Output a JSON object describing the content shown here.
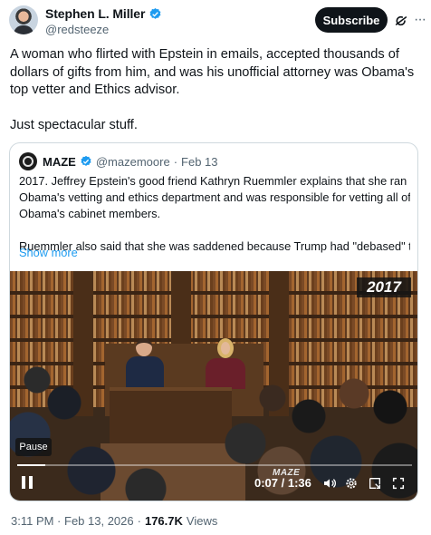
{
  "author": {
    "display_name": "Stephen L. Miller",
    "handle": "@redsteeze",
    "verified_badge_color": "#1d9bf0"
  },
  "header_actions": {
    "subscribe_label": "Subscribe",
    "grok_icon": "grok-icon",
    "more_icon": "more-horizontal-icon",
    "more_label": "···"
  },
  "tweet": {
    "lines": [
      "A woman who flirted with Epstein in emails, accepted thousands of",
      "dollars of gifts from him, and was his unofficial attorney was Obama's",
      "top vetter and Ethics advisor."
    ],
    "second_paragraph": "Just spectacular stuff."
  },
  "quote": {
    "display_name": "MAZE",
    "handle": "@mazemoore",
    "separator": "·",
    "date": "Feb 13",
    "lines": [
      "2017. Jeffrey Epstein's good friend Kathryn Ruemmler explains that she ran",
      "Obama's vetting and ethics department and was responsible for vetting all of",
      "Obama's cabinet members."
    ],
    "second_paragraph": "Ruemmler also said that she was saddened because Trump had \"debased\" t...",
    "show_more_label": "Show more",
    "video": {
      "year_badge": "2017",
      "pause_tooltip": "Pause",
      "watermark": "MAZE",
      "time_display": "0:07 / 1:36",
      "progress": 0.07,
      "controls": [
        "volume-icon",
        "settings-icon",
        "picture-in-picture-icon",
        "fullscreen-icon"
      ]
    }
  },
  "meta": {
    "timestamp": "3:11 PM · Feb 13, 2026",
    "separator": "·",
    "views_count": "176.7K",
    "views_label": "Views"
  }
}
